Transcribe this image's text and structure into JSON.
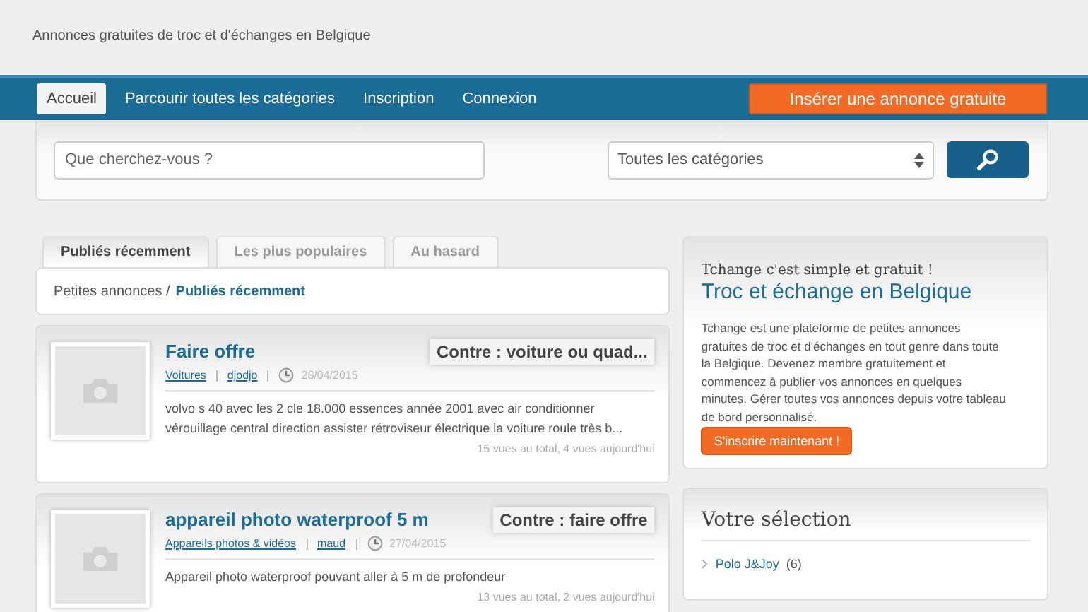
{
  "tagline": "Annonces gratuites de troc et d'échanges en Belgique",
  "nav": {
    "items": [
      {
        "label": "Accueil",
        "selected": true
      },
      {
        "label": "Parcourir toutes les catégories",
        "selected": false
      },
      {
        "label": "Inscription",
        "selected": false
      },
      {
        "label": "Connexion",
        "selected": false
      }
    ],
    "cta": "Insérer une annonce gratuite"
  },
  "search": {
    "placeholder": "Que cherchez-vous ?",
    "category": "Toutes les catégories"
  },
  "tabs": [
    {
      "label": "Publiés récemment",
      "selected": true
    },
    {
      "label": "Les plus populaires",
      "selected": false
    },
    {
      "label": "Au hasard",
      "selected": false
    }
  ],
  "breadcrumb": {
    "root": "Petites annonces /",
    "current": "Publiés récemment"
  },
  "listings": [
    {
      "title": "Faire offre",
      "exchange": "Contre : voiture ou quad...",
      "category": "Voitures",
      "user": "djodjo",
      "date": "28/04/2015",
      "description": "volvo s 40 avec les 2 cle 18.000 essences année 2001 avec air conditionner vérouillage central direction assister rétroviseur électrique la voiture roule très b...",
      "views": "15 vues au total, 4 vues aujourd'hui"
    },
    {
      "title": "appareil photo waterproof 5 m",
      "exchange": "Contre : faire offre",
      "category": "Appareils photos & vidéos",
      "user": "maud",
      "date": "27/04/2015",
      "description": "Appareil photo waterproof pouvant aller à 5 m de profondeur",
      "views": "13 vues au total, 2 vues aujourd'hui"
    }
  ],
  "promo": {
    "kicker": "Tchange c'est simple et gratuit !",
    "title": "Troc et échange en Belgique",
    "text": "Tchange est une plateforme de petites annonces gratuites de troc et d'échanges en tout genre dans toute la Belgique. Devenez membre gratuitement et commencez à publier vos annonces en quelques minutes. Gérer toutes vos annonces depuis votre tableau de bord personnalisé.",
    "button": "S'inscrire maintenant !"
  },
  "selection": {
    "title": "Votre sélection",
    "items": [
      {
        "label": "Polo J&Joy",
        "count": "(6)"
      }
    ]
  }
}
